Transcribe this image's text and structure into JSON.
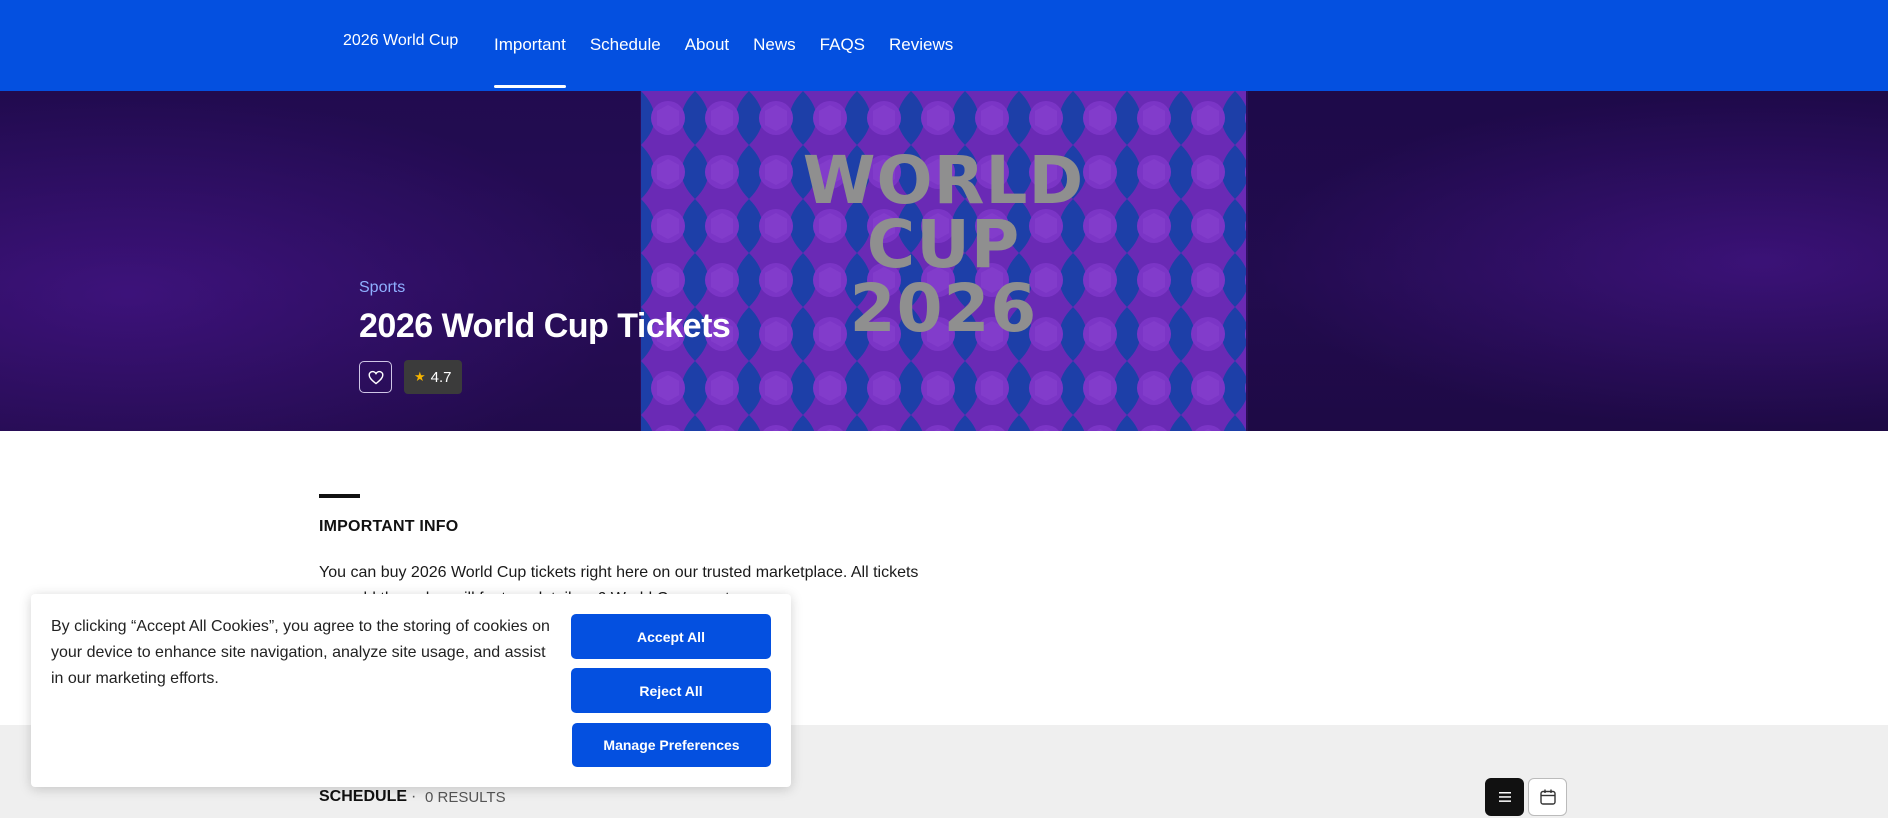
{
  "nav": {
    "brand": "2026 World Cup",
    "links": [
      "Important",
      "Schedule",
      "About",
      "News",
      "FAQS",
      "Reviews"
    ],
    "active_link": "Important"
  },
  "hero": {
    "category": "Sports",
    "title": "2026 World Cup Tickets",
    "rating": "4.7",
    "art_lines": [
      "WORLD",
      "CUP",
      "2026"
    ]
  },
  "important_info": {
    "heading": "IMPORTANT INFO",
    "text": "You can buy 2026 World Cup tickets right here on our trusted marketplace. All tickets are sold through... will feature details ...6 World Cup events"
  },
  "schedule": {
    "title": "SCHEDULE",
    "separator": "·",
    "results": "0 RESULTS"
  },
  "cookie_banner": {
    "text": "By clicking “Accept All Cookies”, you agree to the storing of cookies on your device to enhance site navigation, analyze site usage, and assist in our marketing efforts.",
    "accept_label": "Accept All",
    "reject_label": "Reject All",
    "manage_label": "Manage Preferences"
  },
  "colors": {
    "brand_blue": "#0450e0",
    "hero_purple": "#321066",
    "star": "#f5b400"
  }
}
